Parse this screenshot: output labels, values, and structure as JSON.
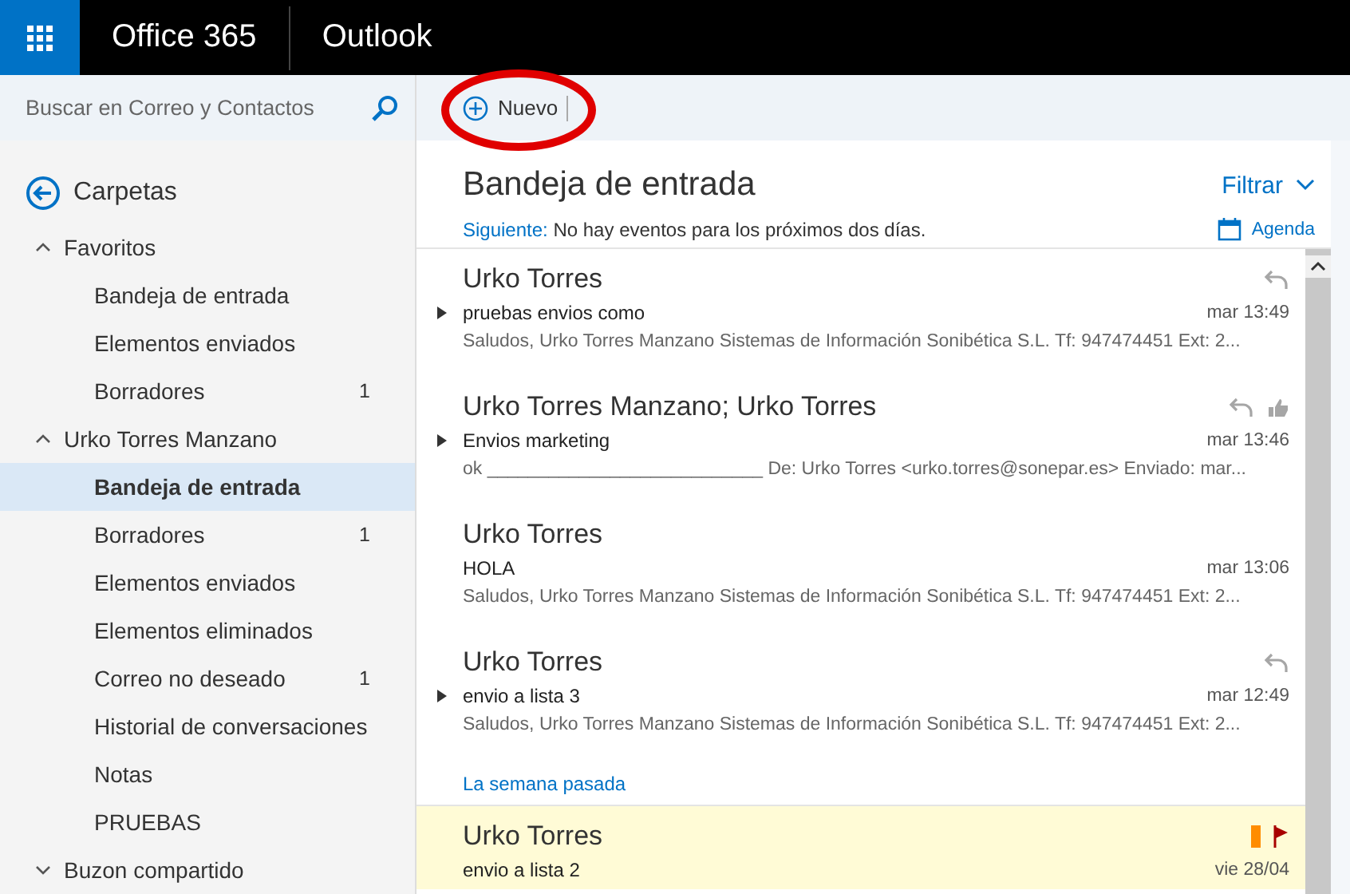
{
  "top_bar": {
    "suite_name": "Office 365",
    "app_name": "Outlook"
  },
  "search": {
    "placeholder": "Buscar en Correo y Contactos"
  },
  "toolbar": {
    "new_button": "Nuevo"
  },
  "sidebar": {
    "back_label": "Carpetas",
    "groups": [
      {
        "label": "Favoritos",
        "expanded": true,
        "children": [
          {
            "label": "Bandeja de entrada",
            "selected": false
          },
          {
            "label": "Elementos enviados",
            "selected": false
          },
          {
            "label": "Borradores",
            "count": "1",
            "selected": false
          }
        ]
      },
      {
        "label": "Urko Torres Manzano",
        "expanded": true,
        "children": [
          {
            "label": "Bandeja de entrada",
            "selected": true
          },
          {
            "label": "Borradores",
            "count": "1",
            "selected": false
          },
          {
            "label": "Elementos enviados",
            "selected": false
          },
          {
            "label": "Elementos eliminados",
            "selected": false
          },
          {
            "label": "Correo no deseado",
            "count": "1",
            "selected": false
          },
          {
            "label": "Historial de conversaciones",
            "selected": false
          },
          {
            "label": "Notas",
            "selected": false
          },
          {
            "label": "PRUEBAS",
            "selected": false
          }
        ]
      },
      {
        "label": "Buzon compartido",
        "expanded": false
      }
    ]
  },
  "inbox": {
    "title": "Bandeja de entrada",
    "filter": "Filtrar",
    "next_label": "Siguiente:",
    "next_text": "No hay eventos para los próximos dos días.",
    "agenda": "Agenda"
  },
  "messages": [
    {
      "kind": "message",
      "sender": "Urko Torres",
      "subject": "pruebas envios como",
      "time": "mar 13:49",
      "preview": "Saludos, Urko Torres Manzano Sistemas de Información Sonibética S.L. Tf: 947474451 Ext: 2...",
      "thread": true,
      "replied": true,
      "liked": false,
      "flagged": false,
      "highlighted": false
    },
    {
      "kind": "message",
      "sender": "Urko Torres Manzano; Urko Torres",
      "subject": "Envios marketing",
      "time": "mar 13:46",
      "preview": "ok ___________________________ De: Urko Torres <urko.torres@sonepar.es> Enviado: mar...",
      "thread": true,
      "replied": true,
      "liked": true,
      "flagged": false,
      "highlighted": false
    },
    {
      "kind": "message",
      "sender": "Urko Torres",
      "subject": "HOLA",
      "time": "mar 13:06",
      "preview": "Saludos, Urko Torres Manzano Sistemas de Información Sonibética S.L. Tf: 947474451 Ext: 2...",
      "thread": false,
      "replied": false,
      "liked": false,
      "flagged": false,
      "highlighted": false
    },
    {
      "kind": "message",
      "sender": "Urko Torres",
      "subject": "envio a lista 3",
      "time": "mar 12:49",
      "preview": "Saludos, Urko Torres Manzano Sistemas de Información Sonibética S.L. Tf: 947474451 Ext: 2...",
      "thread": true,
      "replied": true,
      "liked": false,
      "flagged": false,
      "highlighted": false
    },
    {
      "kind": "section",
      "label": "La semana pasada"
    },
    {
      "kind": "message",
      "sender": "Urko Torres",
      "subject": "envio a lista 2",
      "time": "vie 28/04",
      "thread": false,
      "replied": false,
      "liked": false,
      "flagged": true,
      "highlighted": true,
      "color": "#ff8c00"
    }
  ]
}
